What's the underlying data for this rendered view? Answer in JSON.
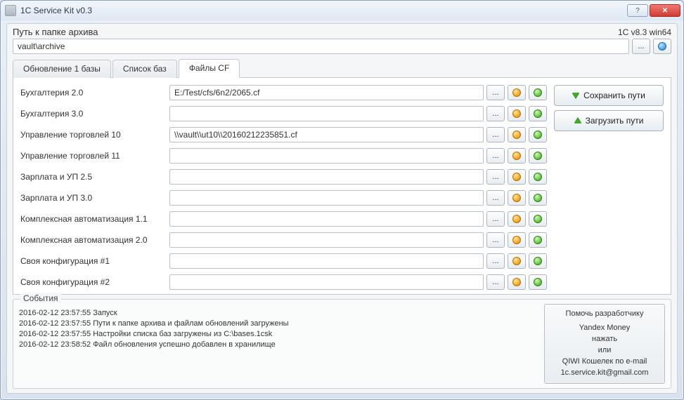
{
  "titlebar": {
    "title": "1C Service Kit v0.3",
    "help": "?",
    "close": "✕"
  },
  "header": {
    "path_label": "Путь к папке архива",
    "version": "1C v8.3 win64",
    "archive_path": "vault\\archive",
    "browse": "..."
  },
  "tabs": {
    "t1": "Обновление 1 базы",
    "t2": "Список баз",
    "t3": "Файлы CF"
  },
  "cf": {
    "browse": "...",
    "rows": [
      {
        "label": "Бухгалтерия 2.0",
        "value": "E:/Test/cfs/6n2/2065.cf"
      },
      {
        "label": "Бухгалтерия 3.0",
        "value": ""
      },
      {
        "label": "Управление торговлей 10",
        "value": "\\\\vault\\\\ut10\\\\20160212235851.cf"
      },
      {
        "label": "Управление торговлей 11",
        "value": ""
      },
      {
        "label": "Зарплата и УП 2.5",
        "value": ""
      },
      {
        "label": "Зарплата и УП 3.0",
        "value": ""
      },
      {
        "label": "Комплексная автоматизация 1.1",
        "value": ""
      },
      {
        "label": "Комплексная автоматизация 2.0",
        "value": ""
      },
      {
        "label": "Своя конфигурация #1",
        "value": ""
      },
      {
        "label": "Своя конфигурация #2",
        "value": ""
      }
    ]
  },
  "actions": {
    "save": "Сохранить пути",
    "load": "Загрузить пути"
  },
  "events": {
    "title": "События",
    "log": [
      "2016-02-12 23:57:55 Запуск",
      "2016-02-12 23:57:55 Пути к папке архива и файлам обновлений загружены",
      "2016-02-12 23:57:55 Настройки списка баз загружены из C:\\bases.1csk",
      "2016-02-12 23:58:52 Файл обновления успешно добавлен в хранилище"
    ]
  },
  "donate": {
    "l1": "Помочь разработчику",
    "l2": "Yandex Money",
    "l3": "нажать",
    "l4": "или",
    "l5": "QIWI Кошелек по e-mail",
    "l6": "1c.service.kit@gmail.com"
  }
}
